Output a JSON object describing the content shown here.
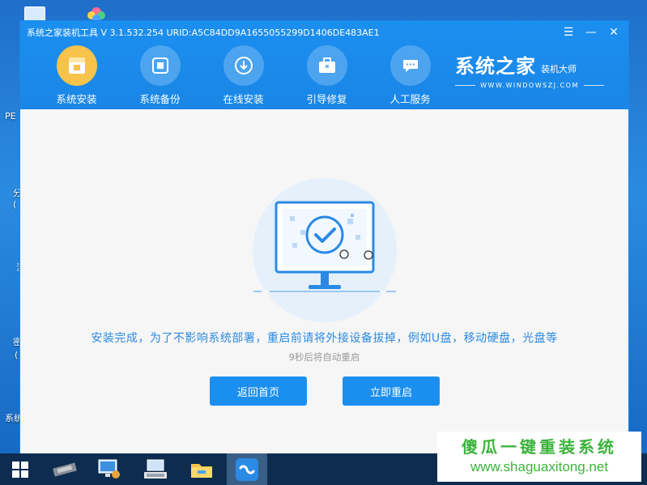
{
  "desktop": {
    "labels": [
      "PE",
      "分",
      "(",
      "流",
      "密",
      "(",
      "系统"
    ]
  },
  "window": {
    "title": "系统之家装机工具 V 3.1.532.254 URID:A5C84DD9A1655055299D1406DE483AE1",
    "controls": {
      "menu": "☰",
      "minimize": "—",
      "close": "✕"
    }
  },
  "nav": {
    "items": [
      {
        "label": "系统安装",
        "icon": "box-icon",
        "active": true
      },
      {
        "label": "系统备份",
        "icon": "cube-backup-icon",
        "active": false
      },
      {
        "label": "在线安装",
        "icon": "download-icon",
        "active": false
      },
      {
        "label": "引导修复",
        "icon": "toolbox-icon",
        "active": false
      },
      {
        "label": "人工服务",
        "icon": "chat-icon",
        "active": false
      }
    ]
  },
  "brand": {
    "name": "系统之家",
    "subtitle": "装机大师",
    "url": "WWW.WINDOWSZJ.COM"
  },
  "content": {
    "message": "安装完成，为了不影响系统部署，重启前请将外接设备拔掉，例如U盘，移动硬盘，光盘等",
    "countdown": "9秒后将自动重启",
    "home_button": "返回首页",
    "restart_button": "立即重启"
  },
  "colors": {
    "accent": "#1b8ff0",
    "active_nav": "#f7c34b",
    "message": "#2a8ae4",
    "watermark": "#3bb43b"
  },
  "taskbar": {
    "items": [
      "windows-start-icon",
      "hardware-chip-icon",
      "computer-settings-icon",
      "keyboard-monitor-icon",
      "folder-icon",
      "installer-app-icon"
    ]
  },
  "watermark": {
    "title": "傻瓜一键重装系统",
    "url": "www.shaguaxitong.net"
  }
}
